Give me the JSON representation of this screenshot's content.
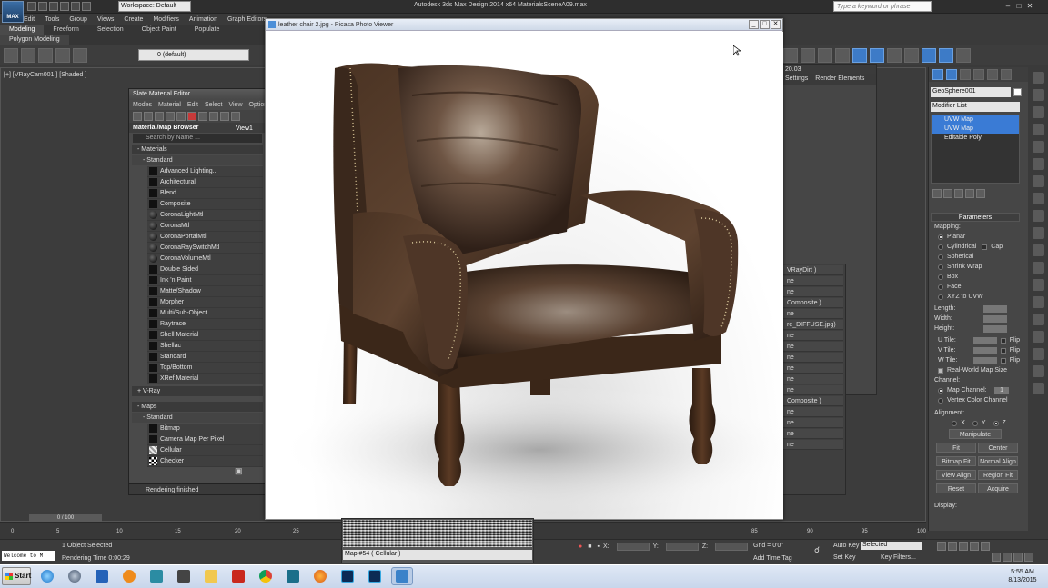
{
  "titlebar": {
    "logo": "MAX",
    "workspace": "Workspace: Default",
    "app_title": "Autodesk 3ds Max Design 2014 x64      MaterialsSceneA09.max",
    "search_placeholder": "Type a keyword or phrase"
  },
  "menu": [
    "Edit",
    "Tools",
    "Group",
    "Views",
    "Create",
    "Modifiers",
    "Animation",
    "Graph Editors"
  ],
  "ribbon": {
    "tabs": [
      "Modeling",
      "Freeform",
      "Selection",
      "Object Paint",
      "Populate"
    ],
    "sub_tab": "Polygon Modeling"
  },
  "toolbar": {
    "layer": "0 (default)"
  },
  "viewport": {
    "label": "[+] [VRayCam001 ] [Shaded ]"
  },
  "slate": {
    "title": "Slate Material Editor",
    "menu": [
      "Modes",
      "Material",
      "Edit",
      "Select",
      "View",
      "Options"
    ],
    "browser_title": "Material/Map Browser",
    "search_placeholder": "Search by Name ...",
    "view_tab": "View1",
    "materials_header": "- Materials",
    "standard_header": "- Standard",
    "materials": [
      {
        "name": "Advanced Lighting...",
        "icon": "black-square"
      },
      {
        "name": "Architectural",
        "icon": "black-square"
      },
      {
        "name": "Blend",
        "icon": "black-square"
      },
      {
        "name": "Composite",
        "icon": "black-square"
      },
      {
        "name": "CoronaLightMtl",
        "icon": "sphere"
      },
      {
        "name": "CoronaMtl",
        "icon": "sphere"
      },
      {
        "name": "CoronaPortalMtl",
        "icon": "sphere"
      },
      {
        "name": "CoronaRaySwitchMtl",
        "icon": "sphere"
      },
      {
        "name": "CoronaVolumeMtl",
        "icon": "sphere"
      },
      {
        "name": "Double Sided",
        "icon": "black-square"
      },
      {
        "name": "Ink 'n Paint",
        "icon": "black-square"
      },
      {
        "name": "Matte/Shadow",
        "icon": "black-square"
      },
      {
        "name": "Morpher",
        "icon": "black-square"
      },
      {
        "name": "Multi/Sub-Object",
        "icon": "black-square"
      },
      {
        "name": "Raytrace",
        "icon": "black-square"
      },
      {
        "name": "Shell Material",
        "icon": "black-square"
      },
      {
        "name": "Shellac",
        "icon": "black-square"
      },
      {
        "name": "Standard",
        "icon": "black-square"
      },
      {
        "name": "Top/Bottom",
        "icon": "black-square"
      },
      {
        "name": "XRef Material",
        "icon": "black-square"
      }
    ],
    "vray_header": "+ V-Ray",
    "maps_header": "- Maps",
    "maps_standard_header": "- Standard",
    "maps": [
      {
        "name": "Bitmap",
        "icon": "black-square"
      },
      {
        "name": "Camera Map Per Pixel",
        "icon": "black-square"
      },
      {
        "name": "Cellular",
        "icon": "cellular"
      },
      {
        "name": "Checker",
        "icon": "checker"
      }
    ],
    "status": "Rendering finished"
  },
  "picasa": {
    "title": "leather chair 2.jpg - Picasa Photo Viewer"
  },
  "render_setup": {
    "tabs": [
      "Settings",
      "Render Elements"
    ],
    "fragment": "20.03"
  },
  "node_panel": {
    "rows": [
      "VRayDirt )",
      "ne",
      "ne",
      "Composite )",
      "ne",
      "re_DIFFUSE.jpg)",
      "ne",
      "ne",
      "ne",
      "ne",
      "ne",
      "ne",
      "Composite )",
      "ne",
      "ne",
      "ne",
      "ne"
    ]
  },
  "command_panel": {
    "object_name": "GeoSphere001",
    "modifier_list": "Modifier List",
    "stack": [
      {
        "label": "UVW Map",
        "selected": true
      },
      {
        "label": "UVW Map",
        "selected": true
      },
      {
        "label": "Editable Poly",
        "selected": false
      }
    ],
    "params_title": "Parameters",
    "mapping_label": "Mapping:",
    "mapping_options": [
      {
        "label": "Planar",
        "on": true
      },
      {
        "label": "Cylindrical",
        "on": false
      },
      {
        "label": "Spherical",
        "on": false
      },
      {
        "label": "Shrink Wrap",
        "on": false
      },
      {
        "label": "Box",
        "on": false
      },
      {
        "label": "Face",
        "on": false
      },
      {
        "label": "XYZ to UVW",
        "on": false
      }
    ],
    "cap_label": "Cap",
    "dims": [
      "Length:",
      "Width:",
      "Height:"
    ],
    "tiles": [
      "U Tile:",
      "V Tile:",
      "W Tile:"
    ],
    "flip_label": "Flip",
    "real_world": "Real-World Map Size",
    "channel_label": "Channel:",
    "map_channel": "Map Channel:",
    "map_channel_value": "1",
    "vertex_color": "Vertex Color Channel",
    "alignment_label": "Alignment:",
    "axes": [
      "X",
      "Y",
      "Z"
    ],
    "buttons": [
      "Manipulate",
      "Fit",
      "Center",
      "Bitmap Fit",
      "Normal Align",
      "View Align",
      "Region Fit",
      "Reset",
      "Acquire"
    ],
    "display_label": "Display:"
  },
  "timeline": {
    "frame": "0 / 100",
    "ticks": [
      "0",
      "5",
      "10",
      "15",
      "20",
      "25",
      "30",
      "85",
      "90",
      "95",
      "100"
    ]
  },
  "status": {
    "maxscript": "Welcome to M",
    "selected": "1 Object Selected",
    "render_time": "Rendering Time  0:00:29",
    "map_select": "Map #54  ( Cellular )",
    "coord_labels": [
      "X:",
      "Y:",
      "Z:"
    ],
    "grid": "Grid = 0'0\"",
    "add_time_tag": "Add Time Tag",
    "auto_key": "Auto Key",
    "set_key": "Set Key",
    "key_filters": "Key Filters...",
    "selected_dd": "Selected"
  },
  "taskbar": {
    "start": "Start",
    "time": "5:55 AM",
    "date": "8/13/2015"
  }
}
